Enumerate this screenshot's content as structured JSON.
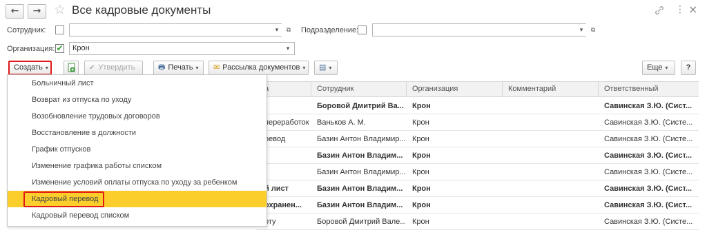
{
  "window": {
    "title": "Все кадровые документы",
    "icons": {
      "back": "arrow-left-icon",
      "forward": "arrow-right-icon",
      "star": "star-icon",
      "link": "link-icon",
      "more": "more-vertical-icon",
      "close": "close-icon"
    },
    "glyphs": {
      "back": "←",
      "forward": "→",
      "star": "☆",
      "link": "🔗",
      "more": "⋮",
      "close": "×",
      "caret": "▾",
      "open": "⧉",
      "check": "✔",
      "print": "🖶",
      "mail": "✉",
      "doc": "▤"
    }
  },
  "filters": {
    "employee_label": "Сотрудник:",
    "employee_value": "",
    "department_label": "Подразделение:",
    "department_value": "",
    "organization_label": "Организация:",
    "organization_value": "Крон",
    "organization_checked": true
  },
  "toolbar": {
    "create_label": "Создать",
    "approve_label": "Утвердить",
    "print_label": "Печать",
    "mailing_label": "Рассылка документов",
    "more_label": "Еще",
    "help_label": "?"
  },
  "table": {
    "columns": [
      "а",
      "Сотрудник",
      "Организация",
      "Комментарий",
      "Ответственный"
    ],
    "rows": [
      {
        "doc": "",
        "employee": "Боровой Дмитрий Ва...",
        "org": "Крон",
        "comment": "",
        "resp": "Савинская З.Ю. (Сист...",
        "bold": true
      },
      {
        "doc": "переработок",
        "employee": "Ваньков А. М.",
        "org": "Крон",
        "comment": "",
        "resp": "Савинская З.Ю. (Систе...",
        "bold": false
      },
      {
        "doc": "ревод",
        "employee": "Базин Антон Владимир...",
        "org": "Крон",
        "comment": "",
        "resp": "Савинская З.Ю. (Систе...",
        "bold": false
      },
      {
        "doc": "",
        "employee": "Базин Антон Владим...",
        "org": "Крон",
        "comment": "",
        "resp": "Савинская З.Ю. (Сист...",
        "bold": true
      },
      {
        "doc": "",
        "employee": "Базин Антон Владимир...",
        "org": "Крон",
        "comment": "",
        "resp": "Савинская З.Ю. (Систе...",
        "bold": false
      },
      {
        "doc": "й лист",
        "employee": "Базин Антон Владим...",
        "org": "Крон",
        "comment": "",
        "resp": "Савинская З.Ю. (Сист...",
        "bold": true
      },
      {
        "doc": "охранен...",
        "employee": "Базин Антон Владим...",
        "org": "Крон",
        "comment": "",
        "resp": "Савинская З.Ю. (Сист...",
        "bold": true
      },
      {
        "doc": "оту",
        "employee": "Боровой Дмитрий Вале...",
        "org": "Крон",
        "comment": "",
        "resp": "Савинская З.Ю. (Систе...",
        "bold": false
      }
    ]
  },
  "menu": {
    "items": [
      "Больничный лист",
      "Возврат из отпуска по уходу",
      "Возобновление трудовых договоров",
      "Восстановление в должности",
      "График отпусков",
      "Изменение графика работы списком",
      "Изменение условий оплаты отпуска по уходу за ребенком",
      "Кадровый перевод",
      "Кадровый перевод списком"
    ],
    "selected_index": 7
  },
  "colors": {
    "highlight": "#fbce2c",
    "annotation": "#e01818",
    "check": "#2e9e2e"
  }
}
